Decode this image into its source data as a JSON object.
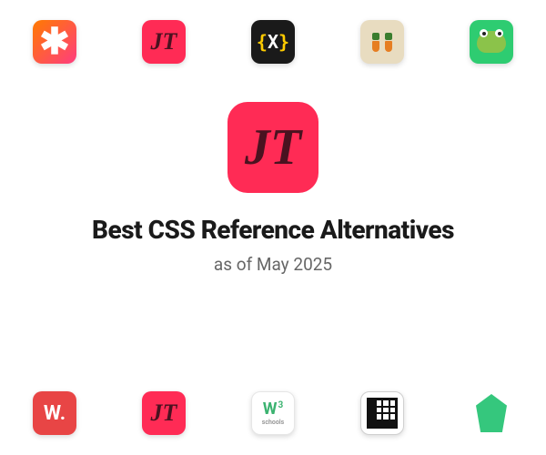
{
  "page": {
    "title": "Best CSS Reference Alternatives",
    "subtitle": "as of May 2025"
  },
  "hero_icon": {
    "name": "css-reference",
    "glyph": "JT"
  },
  "top_icons": [
    {
      "name": "svg-backgrounds",
      "glyph": "✱"
    },
    {
      "name": "css-reference-small",
      "glyph": "JT"
    },
    {
      "name": "css-battle",
      "glyph": "{X}"
    },
    {
      "name": "grid-garden",
      "glyph": "carrot"
    },
    {
      "name": "flexbox-froggy",
      "glyph": "frog"
    }
  ],
  "bottom_icons": [
    {
      "name": "awwwards",
      "glyph": "W."
    },
    {
      "name": "css-reference-small-2",
      "glyph": "JT"
    },
    {
      "name": "w3schools",
      "glyph": "W",
      "sup": "3",
      "sub": "schools"
    },
    {
      "name": "learn-css-grid",
      "glyph": "grid"
    },
    {
      "name": "bulma",
      "glyph": "shape"
    }
  ]
}
